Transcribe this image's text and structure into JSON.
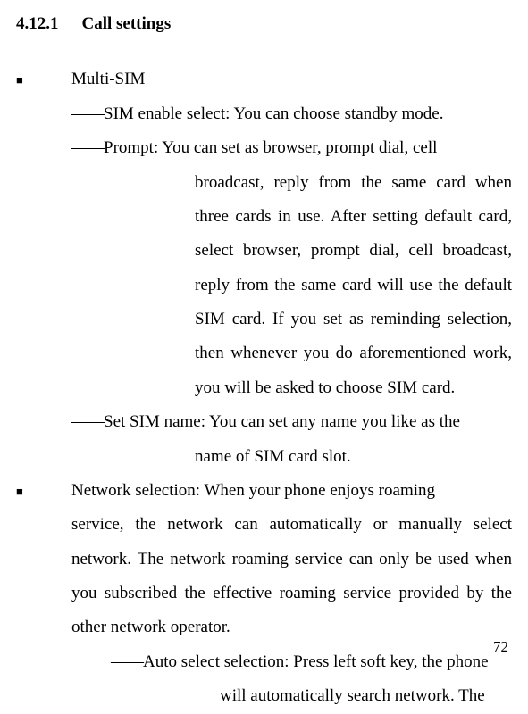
{
  "header": {
    "number": "4.12.1",
    "title": "Call settings"
  },
  "bullet1": {
    "label": "Multi-SIM"
  },
  "sim_enable": {
    "prefix": "――",
    "text": "SIM enable select: You can choose standby mode."
  },
  "prompt": {
    "prefix": "――",
    "line1": "Prompt: You can set as browser, prompt dial, cell",
    "cont": "broadcast, reply from the same card when three cards in use. After setting default card, select browser, prompt dial, cell broadcast, reply from the same card will use the default SIM card. If you set as reminding selection, then whenever you do aforementioned work, you will be asked to choose SIM card."
  },
  "set_sim": {
    "prefix": "――",
    "line1": "Set SIM name: You can set any name you like as the",
    "cont": "name of SIM card slot."
  },
  "bullet2": {
    "line1": "Network selection: When your phone enjoys roaming",
    "cont": "service, the network can automatically or manually select network. The network roaming service can only be used when you subscribed the effective roaming service provided by the other network operator."
  },
  "auto_select": {
    "prefix": "――",
    "line1": "Auto select selection: Press left soft key, the phone",
    "cont": "will automatically search network. The"
  },
  "page_number": "72"
}
